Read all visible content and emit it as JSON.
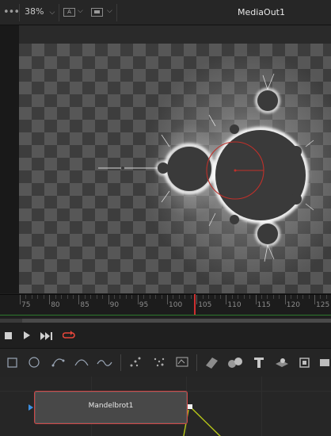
{
  "viewer": {
    "zoom": "38%",
    "channel_label": "A",
    "title": "MediaOut1"
  },
  "timeline": {
    "ticks": [
      "75",
      "80",
      "85",
      "90",
      "95",
      "100",
      "105",
      "110",
      "115",
      "120",
      "125"
    ],
    "current_frame": 104
  },
  "transport": {
    "buttons": [
      "stop-icon",
      "play-icon",
      "skip-to-end-icon",
      "loop-icon"
    ]
  },
  "toolbar": {
    "tools": [
      "rectangle-mask-icon",
      "ellipse-mask-icon",
      "polygon-mask-icon",
      "bspline-mask-icon",
      "paint-icon",
      "particles-icon",
      "particle-emitter-icon",
      "text-icon",
      "image-plane-3d-icon",
      "shape-3d-icon",
      "text-3d-icon",
      "merge-3d-icon",
      "renderer-3d-icon",
      "camera-3d-icon"
    ]
  },
  "node_editor": {
    "node_name": "Mandelbrot1"
  },
  "colors": {
    "playhead": "#d03030",
    "node_border": "#d04545",
    "connection": "#b7c619",
    "loop_accent": "#e8473b",
    "input_marker": "#3d8fe0"
  }
}
